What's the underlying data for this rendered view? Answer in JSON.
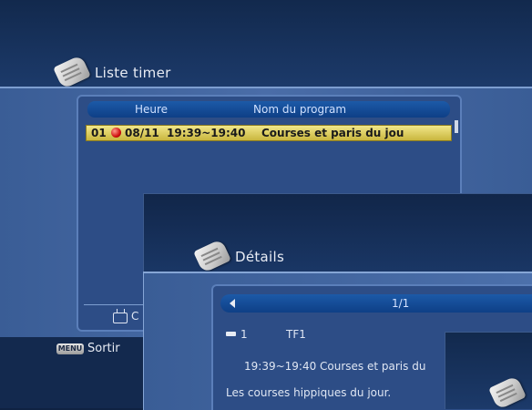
{
  "timer_list": {
    "title": "Liste timer",
    "header": {
      "time_col": "Heure",
      "program_col": "Nom du program"
    },
    "rows": [
      {
        "index": "01",
        "date": "08/11",
        "time": "19:39~19:40",
        "program": "Courses et paris du jou",
        "selected": true
      }
    ],
    "footer_hint": "C"
  },
  "footer": {
    "menu_key": "MENU",
    "exit_label": "Sortir"
  },
  "details": {
    "title": "Détails",
    "page": "1/1",
    "channel_number": "1",
    "channel_name": "TF1",
    "time_line": "19:39~19:40 Courses et paris du",
    "description": "Les courses hippiques du jour."
  },
  "colors": {
    "selection": "#e0d060",
    "record_dot": "#d01010",
    "header_bar": "#1c5aa8",
    "panel": "#2d4d86"
  }
}
